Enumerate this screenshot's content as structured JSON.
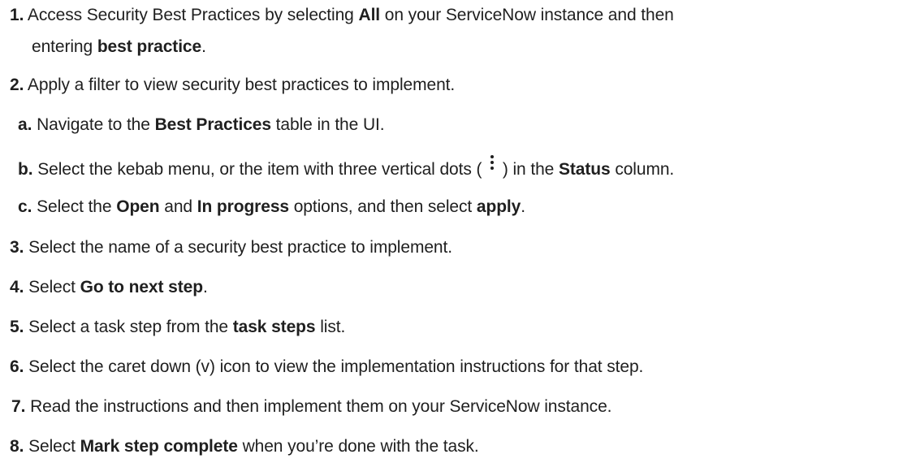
{
  "steps": [
    {
      "num": "1.",
      "line1": {
        "t1": "Access Security Best Practices by selecting ",
        "b1": "All",
        "t2": " on your ServiceNow instance and then"
      },
      "line2": {
        "t1": "entering ",
        "b1": "best practice",
        "t2": "."
      }
    },
    {
      "num": "2.",
      "text": "Apply a filter to view security best practices to implement."
    },
    {
      "num": "a.",
      "t1": "Navigate to the ",
      "b1": "Best Practices",
      "t2": " table in the UI."
    },
    {
      "num": "b.",
      "t1": "Select the kebab menu, or the item with three vertical dots ( ",
      "icon": "kebab-vertical-dots-icon",
      "t2": " ) in the ",
      "b1": "Status",
      "t3": " column."
    },
    {
      "num": "c.",
      "t1": "Select the ",
      "b1": "Open",
      "t2": " and ",
      "b2": "In progress",
      "t3": " options, and then select ",
      "b3": "apply",
      "t4": "."
    },
    {
      "num": "3.",
      "text": "Select the name of a security best practice to implement."
    },
    {
      "num": "4.",
      "t1": "Select ",
      "b1": "Go to next step",
      "t2": "."
    },
    {
      "num": "5.",
      "t1": "Select a task step from the ",
      "b1": "task steps",
      "t2": " list."
    },
    {
      "num": "6.",
      "text": "Select the caret down (v) icon to view the implementation instructions for that step."
    },
    {
      "num": "7.",
      "text": "Read the instructions and then implement them on your ServiceNow instance."
    },
    {
      "num": "8.",
      "t1": "Select ",
      "b1": "Mark step complete",
      "t2": " when you’re done with the task."
    }
  ]
}
